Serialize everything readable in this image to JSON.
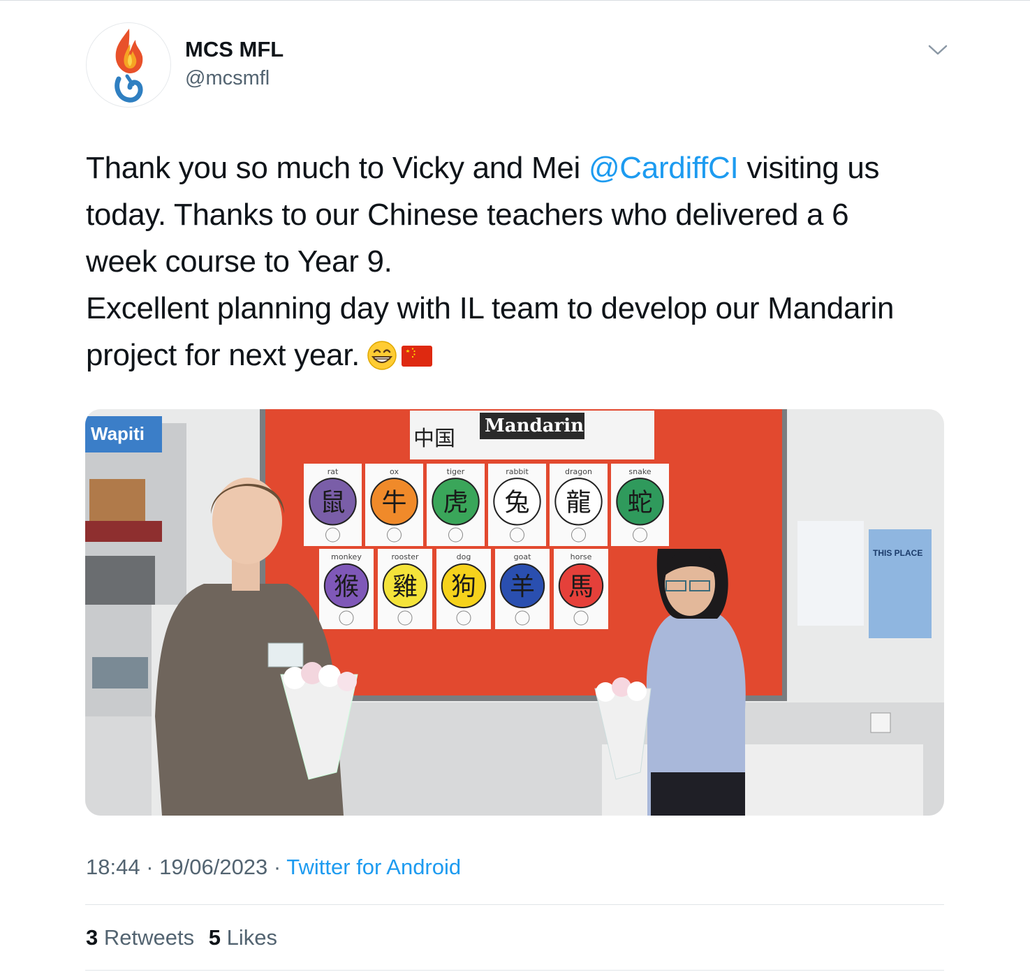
{
  "account": {
    "display_name": "MCS MFL",
    "handle": "@mcsmfl",
    "avatar_icon": "flame-logo"
  },
  "menu": {
    "icon": "chevron-down-icon"
  },
  "tweet": {
    "line1_pre": "Thank you so much to Vicky and Mei ",
    "mention": "@CardiffCI",
    "line1_post": " visiting us",
    "line2": "today. Thanks to our Chinese teachers who delivered a 6",
    "line3": "week course to Year 9.",
    "line4": "Excellent planning day with IL team to develop our Mandarin",
    "line5": "project for next year.",
    "emojis": [
      "grinning-face",
      "flag-china"
    ]
  },
  "media": {
    "banner_text": "Mandarin",
    "banner_chars": "中国",
    "magazine": "Wapiti",
    "poster_title": "THIS PLACE",
    "zodiac_top": [
      {
        "label": "rat",
        "char": "鼠",
        "color": "#7a5ea8"
      },
      {
        "label": "ox",
        "char": "牛",
        "color": "#f08a2a"
      },
      {
        "label": "tiger",
        "char": "虎",
        "color": "#3aa65a"
      },
      {
        "label": "rabbit",
        "char": "兔",
        "color": "#ffffff"
      },
      {
        "label": "dragon",
        "char": "龍",
        "color": "#ffffff"
      },
      {
        "label": "snake",
        "char": "蛇",
        "color": "#2f9a5c"
      }
    ],
    "zodiac_bottom": [
      {
        "label": "monkey",
        "char": "猴",
        "color": "#7f58b8"
      },
      {
        "label": "rooster",
        "char": "雞",
        "color": "#f4e33a"
      },
      {
        "label": "dog",
        "char": "狗",
        "color": "#f6d21c"
      },
      {
        "label": "goat",
        "char": "羊",
        "color": "#2a4fb0"
      },
      {
        "label": "horse",
        "char": "馬",
        "color": "#e5403a"
      }
    ]
  },
  "meta": {
    "time": "18:44",
    "date": "19/06/2023",
    "separator": " · ",
    "source": "Twitter for Android"
  },
  "stats": {
    "retweets_count": "3",
    "retweets_label": "Retweets",
    "likes_count": "5",
    "likes_label": "Likes"
  }
}
